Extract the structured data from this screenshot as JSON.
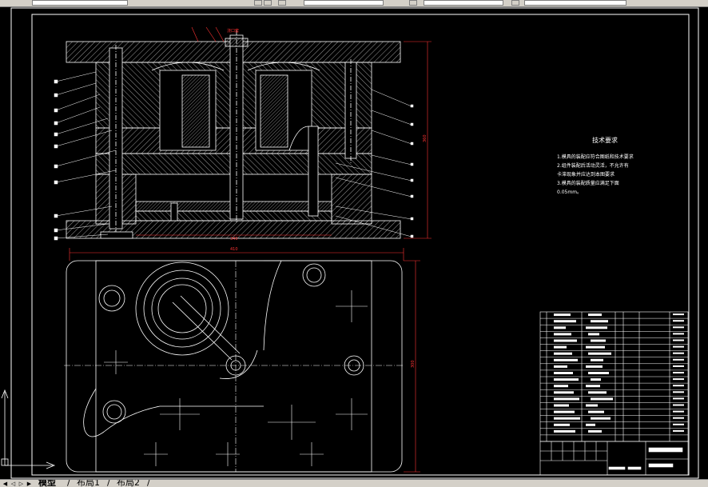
{
  "tabs": [
    {
      "label": "模型",
      "active": true
    },
    {
      "label": "布局1",
      "active": false
    },
    {
      "label": "布局2",
      "active": false
    }
  ],
  "technical_requirements": {
    "title": "技术要求",
    "lines": [
      "1.模具的装配应符合图纸和技术要求",
      "2.组件装配后活动灵活，不允许有",
      "  卡滞现象并应达到本图要求",
      "3.模具的装配质量应满足下面",
      "  0.05mm。"
    ]
  },
  "dimensions": {
    "overall_width": "410",
    "section_width": "340",
    "section_height": "360",
    "plan_height": "300",
    "top_callout": "浇口套"
  },
  "colors": {
    "background": "#000000",
    "geometry": "#ffffff",
    "dimension": "#ff3333",
    "frame": "#ffffff"
  }
}
